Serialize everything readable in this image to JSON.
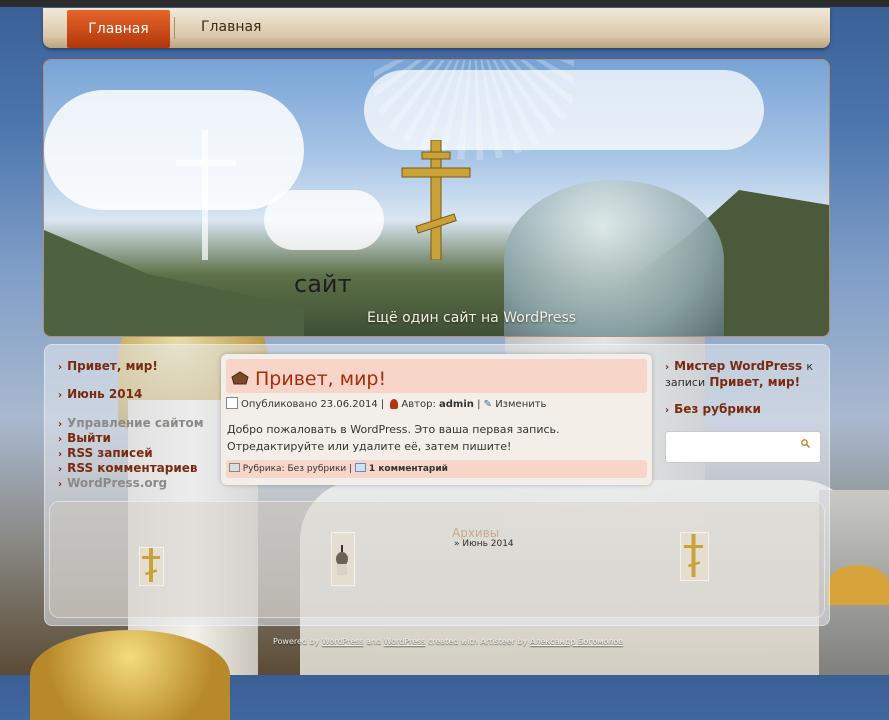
{
  "nav": {
    "active_label": "Главная",
    "item_label": "Главная"
  },
  "header": {
    "site_title": "сайт",
    "site_description": "Ещё один сайт на WordPress"
  },
  "left_sidebar": {
    "recent_post": "Привет, мир!",
    "archive_month": "Июнь 2014",
    "meta_links": [
      {
        "label": "Управление сайтом"
      },
      {
        "label": "Выйти"
      },
      {
        "label": "RSS записей"
      },
      {
        "label": "RSS комментариев"
      },
      {
        "label": "WordPress.org"
      }
    ]
  },
  "post": {
    "title": "Привет, мир!",
    "published_label": "Опубликовано",
    "date": "23.06.2014",
    "author_label": "Автор:",
    "author": "admin",
    "edit_label": "Изменить",
    "body": "Добро пожаловать в WordPress. Это ваша первая запись. Отредактируйте или удалите её, затем пишите!",
    "category_label": "Рубрика:",
    "category": "Без рубрики",
    "comments": "1 комментарий"
  },
  "right_sidebar": {
    "comment_author": "Мистер WordPress",
    "comment_connector": "к записи",
    "comment_post": "Привет, мир!",
    "category": "Без рубрики",
    "search_placeholder": ""
  },
  "bottom": {
    "archives_title": "Архивы",
    "archive_item": "Июнь 2014"
  },
  "footer": {
    "powered_by": "Powered by",
    "wp1": "WordPress",
    "and": "and",
    "wp2": "WordPress",
    "created_with": "created with Artisteer by",
    "designer": "Александр Богомолов"
  },
  "colors": {
    "accent": "#b2360b",
    "link": "#7a2a10",
    "post_title": "#a52d0e",
    "header_band": "#f7d6c9"
  },
  "icons": [
    "post-title-icon",
    "calendar-icon",
    "author-icon",
    "edit-icon",
    "category-icon",
    "comment-icon",
    "search-icon",
    "cross-icon"
  ]
}
